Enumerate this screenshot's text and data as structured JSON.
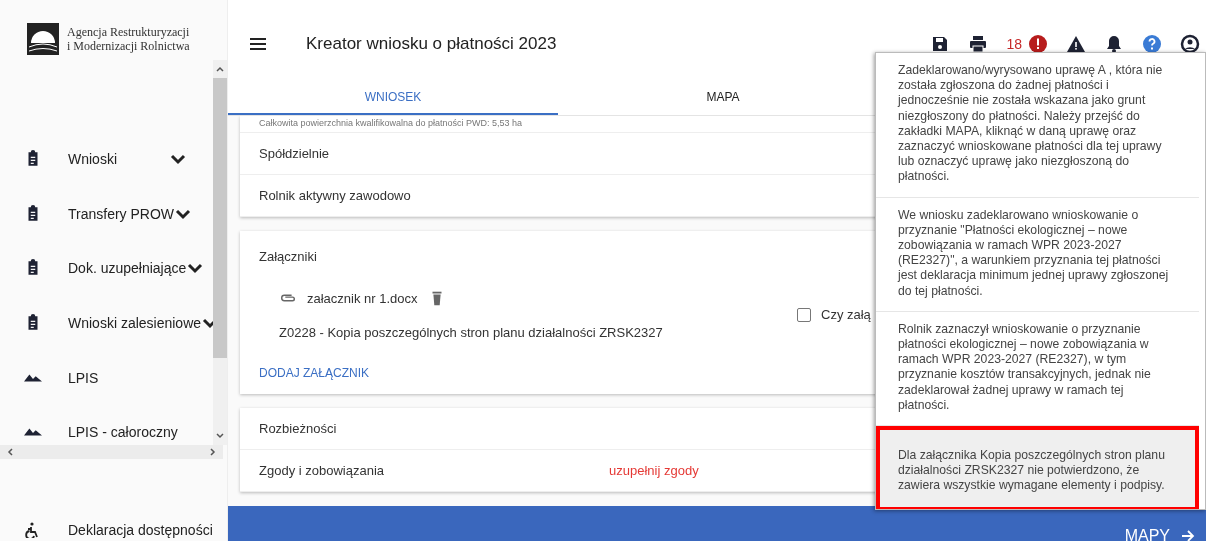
{
  "sidebar": {
    "logo_text": [
      "Agencja Restrukturyzacji",
      "i Modernizacji Rolnictwa"
    ],
    "items": [
      {
        "kind": "clipboard",
        "label": "Wnioski",
        "expandable": true
      },
      {
        "kind": "clipboard",
        "label": "Transfery PROW",
        "expandable": true
      },
      {
        "kind": "clipboard",
        "label": "Dok. uzupełniające",
        "expandable": true
      },
      {
        "kind": "clipboard",
        "label": "Wnioski zalesieniowe",
        "expandable": true
      },
      {
        "kind": "mountain",
        "label": "LPIS",
        "expandable": false
      },
      {
        "kind": "mountain",
        "label": "LPIS - całoroczny",
        "expandable": false
      }
    ],
    "footer_item": "Deklaracja dostępności"
  },
  "header": {
    "title": "Kreator wniosku o płatności 2023",
    "error_count": "18"
  },
  "tabs": [
    {
      "label": "WNIOSEK",
      "selected": true
    },
    {
      "label": "MAPA",
      "selected": false
    }
  ],
  "summary_note": "Całkowita powierzchnia kwalifikowalna do płatności PWD: 5,53 ha",
  "sections": [
    "Spółdzielnie",
    "Rolnik aktywny zawodowo"
  ],
  "attachments": {
    "title": "Załączniki",
    "file_name": "załacznik nr 1.docx",
    "description": "Z0228 - Kopia poszczególnych stron planu działalności ZRSK2327",
    "checkbox_label": "Czy załą",
    "checked": false,
    "add_button": "DODAJ ZAŁĄCZNIK"
  },
  "lower_sections": [
    {
      "label": "Rozbieżności"
    },
    {
      "label": "Zgody i zobowiązania",
      "status": "uzupełnij zgody"
    }
  ],
  "bottom_bar": {
    "button": "MAPY"
  },
  "messages": [
    {
      "text": "Zadeklarowano/wyrysowano uprawę A , która nie została zgłoszona do żadnej płatności i jednocześnie nie została wskazana jako grunt niezgłoszony do płatności. Należy przejść do zakładki MAPA, kliknąć w daną uprawę oraz zaznaczyć wnioskowane płatności dla tej uprawy lub oznaczyć uprawę jako niezgłoszoną do płatności.",
      "highlighted": false
    },
    {
      "text": "We wniosku zadeklarowano wnioskowanie o przyznanie \"Płatności ekologicznej – nowe zobowiązania w ramach WPR 2023-2027 (RE2327)\", a warunkiem przyznania tej płatności jest deklaracja minimum jednej uprawy zgłoszonej do tej płatności.",
      "highlighted": false
    },
    {
      "text": "Rolnik zaznaczył wnioskowanie o przyznanie płatności ekologicznej – nowe zobowiązania w ramach WPR 2023-2027 (RE2327), w tym przyznanie kosztów transakcyjnych, jednak nie zadeklarował żadnej uprawy w ramach tej płatności.",
      "highlighted": false
    },
    {
      "text": "Dla załącznika Kopia poszczególnych stron planu działalności ZRSK2327 nie potwierdzono, że zawiera wszystkie wymagane elementy i podpisy.",
      "highlighted": true
    }
  ]
}
